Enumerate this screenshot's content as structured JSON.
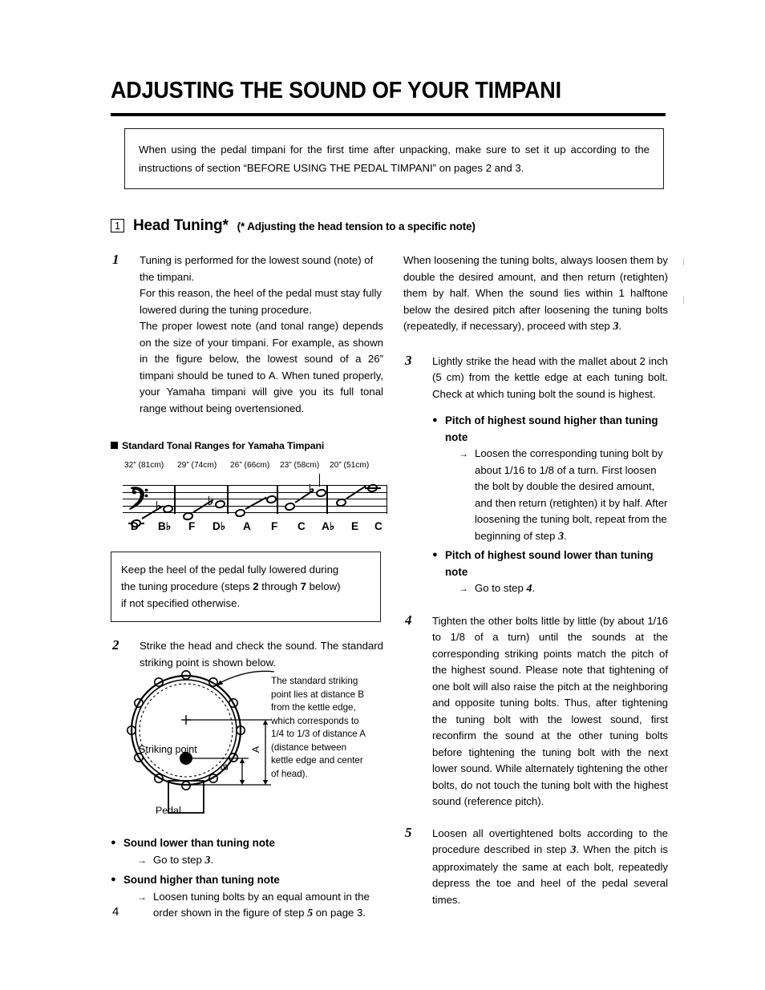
{
  "document": {
    "title": "ADJUSTING THE SOUND OF YOUR TIMPANI",
    "page_number": "4"
  },
  "intro_box": {
    "text": "When using the pedal timpani for the first time after unpacking, make sure to set it up according to the instructions of section “BEFORE USING THE PEDAL TIMPANI” on pages 2 and 3."
  },
  "section": {
    "number": "1",
    "title": "Head Tuning*",
    "subtitle": "(* Adjusting the head tension to a specific note)"
  },
  "left_column": {
    "step1": {
      "number": "1",
      "paragraph1": "Tuning is performed for the lowest sound (note) of the timpani.",
      "paragraph2": "For this reason, the heel of the pedal must stay fully lowered during the tuning procedure.",
      "paragraph3": "The proper lowest note (and tonal range) depends on the size of your timpani. For example, as shown in the figure below, the lowest sound of a 26” timpani should be tuned to A. When tuned properly, your Yamaha timpani will give you its full tonal range without being overtensioned."
    },
    "figure_heading": "Standard Tonal Ranges for Yamaha Timpani",
    "keep_box": {
      "line1": "Keep the heel of the pedal fully lowered during",
      "line2_a": "the tuning procedure (steps ",
      "line2_num1": "2",
      "line2_b": " through ",
      "line2_num2": "7",
      "line2_c": " below)",
      "line3": "if not specified otherwise."
    },
    "step2": {
      "number": "2",
      "paragraph": "Strike the head and check the sound. The standard striking point is shown below."
    },
    "drum_figure": {
      "callout": "The standard striking point lies at distance B from the kettle edge, which corresponds to 1/4 to 1/3 of distance A (distance between kettle edge and center of head).",
      "striking_point_label": "Striking point",
      "pedal_label": "Pedal",
      "dimension_a": "A",
      "dimension_b": "B"
    },
    "bullets": [
      {
        "heading": "Sound lower than tuning note",
        "arrow_pre": "Go to step ",
        "arrow_num": "3",
        "arrow_post": "."
      },
      {
        "heading": "Sound higher than tuning note",
        "arrow_pre": "Loosen tuning bolts by an equal amount in the order shown in the figure of step ",
        "arrow_num": "5",
        "arrow_post": " on page 3."
      }
    ]
  },
  "right_column": {
    "continuation": "When loosening the tuning bolts, always loosen them by double the desired amount, and then return (retighten) them by half. When the sound lies within 1 halftone below the desired pitch after loosening the tuning bolts (repeatedly, if necessary), proceed with step ",
    "continuation_num": "3",
    "continuation_end": ".",
    "step3": {
      "number": "3",
      "paragraph": "Lightly strike the head with the mallet about 2 inch (5 cm) from the kettle edge at each tuning bolt. Check at which tuning bolt the sound is highest.",
      "bullets": [
        {
          "heading": "Pitch of highest sound higher than tuning note",
          "arrow_pre": "Loosen the corresponding tuning bolt by about 1/16 to 1/8 of a turn. First loosen the bolt by double the desired amount, and then return (retighten) it by half. After loosening the tuning bolt, repeat from the beginning of step ",
          "arrow_num": "3",
          "arrow_post": "."
        },
        {
          "heading": "Pitch of highest sound lower than tuning note",
          "arrow_pre": "Go to step ",
          "arrow_num": "4",
          "arrow_post": "."
        }
      ]
    },
    "step4": {
      "number": "4",
      "paragraph": "Tighten the other bolts little by little (by about 1/16 to 1/8 of a turn) until the sounds at the corresponding striking points match the pitch of the highest sound. Please note that tightening of one bolt will also raise the pitch at the neighboring and opposite tuning bolts. Thus, after tightening the tuning bolt with the lowest sound, first reconfirm the sound at the other tuning bolts before tightening the tuning bolt with the next lower sound. While alternately tightening the other bolts, do not touch the tuning bolt with the highest sound (reference pitch)."
    },
    "step5": {
      "number": "5",
      "paragraph_pre": "Loosen all overtightened bolts according to the procedure described in step ",
      "paragraph_num": "3",
      "paragraph_post": ". When the pitch is approximately the same at each bolt, repeatedly depress the toe and heel of the pedal several times."
    }
  },
  "chart_data": {
    "type": "table",
    "title": "Standard Tonal Ranges for Yamaha Timpani",
    "clef": "bass",
    "categories": [
      "32” (81cm)",
      "29” (74cm)",
      "26” (66cm)",
      "23” (58cm)",
      "20” (51cm)"
    ],
    "ranges": [
      {
        "size": "32” (81cm)",
        "low": "D",
        "high": "B♭"
      },
      {
        "size": "29” (74cm)",
        "low": "F",
        "high": "D♭"
      },
      {
        "size": "26” (66cm)",
        "low": "A",
        "high": "F"
      },
      {
        "size": "23” (58cm)",
        "low": "C",
        "high": "A♭"
      },
      {
        "size": "20” (51cm)",
        "low": "E",
        "high": "C"
      }
    ],
    "note_names": [
      "D",
      "B♭",
      "F",
      "D♭",
      "A",
      "F",
      "C",
      "A♭",
      "E",
      "C"
    ]
  }
}
